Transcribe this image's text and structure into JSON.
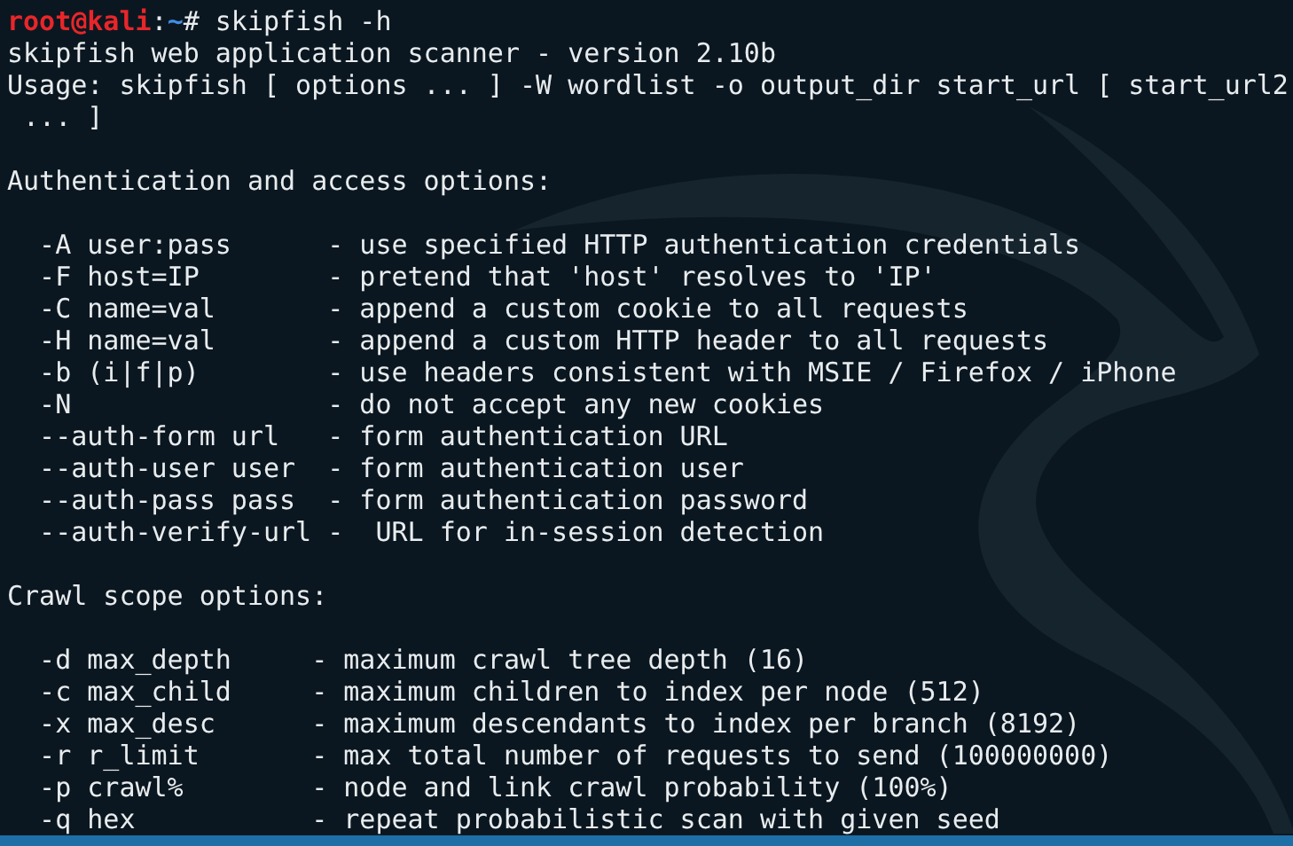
{
  "terminal": {
    "prompt": {
      "user_host": "root@kali",
      "separator": ":",
      "path": "~",
      "symbol": "# ",
      "command": "skipfish -h"
    },
    "lines": [
      {
        "kind": "text",
        "text": "skipfish web application scanner - version 2.10b"
      },
      {
        "kind": "text",
        "text": "Usage: skipfish [ options ... ] -W wordlist -o output_dir start_url [ start_url2"
      },
      {
        "kind": "text",
        "text": " ... ]"
      },
      {
        "kind": "blank"
      },
      {
        "kind": "heading",
        "text": "Authentication and access options:"
      },
      {
        "kind": "blank"
      },
      {
        "kind": "option",
        "flag": "  -A user:pass      ",
        "text": "- use specified HTTP authentication credentials"
      },
      {
        "kind": "option",
        "flag": "  -F host=IP        ",
        "text": "- pretend that 'host' resolves to 'IP'"
      },
      {
        "kind": "option",
        "flag": "  -C name=val       ",
        "text": "- append a custom cookie to all requests"
      },
      {
        "kind": "option",
        "flag": "  -H name=val       ",
        "text": "- append a custom HTTP header to all requests"
      },
      {
        "kind": "option",
        "flag": "  -b (i|f|p)        ",
        "text": "- use headers consistent with MSIE / Firefox / iPhone"
      },
      {
        "kind": "option",
        "flag": "  -N                ",
        "text": "- do not accept any new cookies"
      },
      {
        "kind": "option",
        "flag": "  --auth-form url   ",
        "text": "- form authentication URL"
      },
      {
        "kind": "option",
        "flag": "  --auth-user user  ",
        "text": "- form authentication user"
      },
      {
        "kind": "option",
        "flag": "  --auth-pass pass  ",
        "text": "- form authentication password"
      },
      {
        "kind": "option",
        "flag": "  --auth-verify-url ",
        "text": "-  URL for in-session detection"
      },
      {
        "kind": "blank"
      },
      {
        "kind": "heading",
        "text": "Crawl scope options:"
      },
      {
        "kind": "blank"
      },
      {
        "kind": "option",
        "flag": "  -d max_depth     ",
        "text": "- maximum crawl tree depth (16)"
      },
      {
        "kind": "option",
        "flag": "  -c max_child     ",
        "text": "- maximum children to index per node (512)"
      },
      {
        "kind": "option",
        "flag": "  -x max_desc      ",
        "text": "- maximum descendants to index per branch (8192)"
      },
      {
        "kind": "option",
        "flag": "  -r r_limit       ",
        "text": "- max total number of requests to send (100000000)"
      },
      {
        "kind": "option",
        "flag": "  -p crawl%        ",
        "text": "- node and link crawl probability (100%)"
      },
      {
        "kind": "option",
        "flag": "  -q hex           ",
        "text": "- repeat probabilistic scan with given seed"
      }
    ]
  }
}
